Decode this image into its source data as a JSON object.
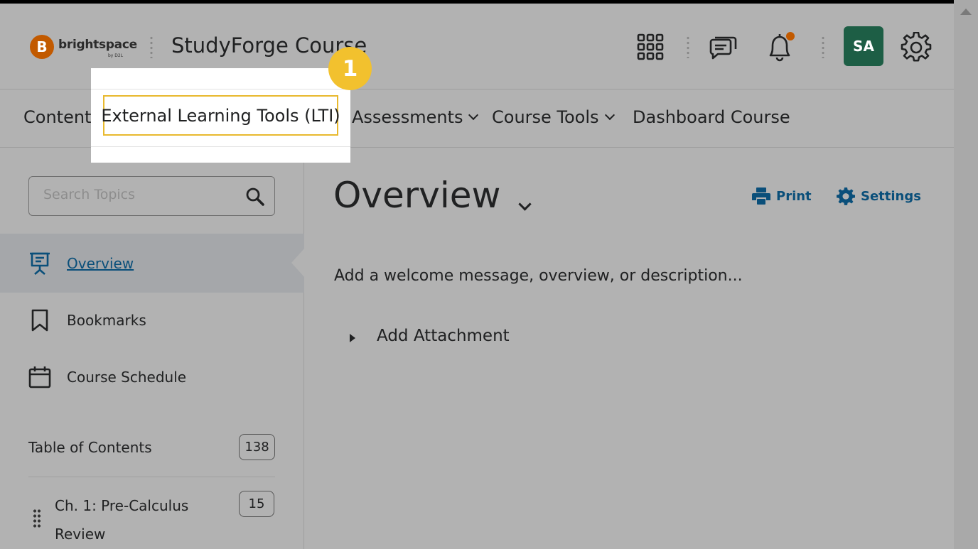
{
  "header": {
    "logo_letter": "B",
    "logo_text": "brightspace",
    "logo_sub": "by D2L",
    "course_title": "StudyForge Course",
    "avatar_initials": "SA"
  },
  "navbar": {
    "items": [
      {
        "label": "Content"
      },
      {
        "label": "External Learning Tools (LTI)"
      },
      {
        "label": "Assessments"
      },
      {
        "label": "Course Tools"
      },
      {
        "label": "Dashboard Course"
      }
    ]
  },
  "highlight": {
    "step_number": "1"
  },
  "sidebar": {
    "search_placeholder": "Search Topics",
    "items": [
      {
        "label": "Overview"
      },
      {
        "label": "Bookmarks"
      },
      {
        "label": "Course Schedule"
      }
    ],
    "toc_label": "Table of Contents",
    "toc_count": "138",
    "chapters": [
      {
        "label": "Ch. 1: Pre-Calculus Review",
        "count": "15"
      }
    ]
  },
  "main": {
    "title": "Overview",
    "print_label": "Print",
    "settings_label": "Settings",
    "welcome_text": "Add a welcome message, overview, or description...",
    "attachment_label": "Add Attachment"
  },
  "colors": {
    "brand_orange": "#c25a00",
    "link_blue": "#0a4f7a",
    "avatar_green": "#1d5e45",
    "highlight_yellow": "#f2c12e"
  }
}
